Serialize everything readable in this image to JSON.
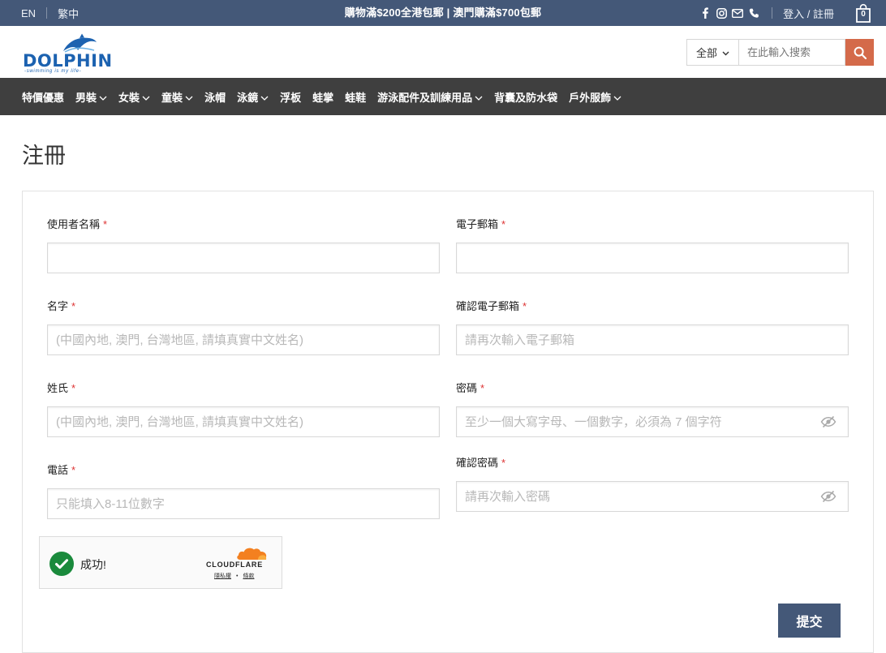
{
  "topbar": {
    "lang_en": "EN",
    "lang_zh": "繁中",
    "promo": "購物滿$200全港包郵 | 澳門購滿$700包郵",
    "login": "登入 / 註冊",
    "cart_count": "0",
    "icons": [
      "facebook-icon",
      "instagram-icon",
      "mail-icon",
      "phone-icon",
      "cart-icon"
    ]
  },
  "logo": {
    "word": "DOLPHIN",
    "tagline": "-swimming is my life-"
  },
  "search": {
    "category": "全部",
    "placeholder": "在此輸入搜索"
  },
  "nav": {
    "items": [
      {
        "label": "特價優惠",
        "dropdown": false
      },
      {
        "label": "男裝",
        "dropdown": true
      },
      {
        "label": "女裝",
        "dropdown": true
      },
      {
        "label": "童裝",
        "dropdown": true
      },
      {
        "label": "泳帽",
        "dropdown": false
      },
      {
        "label": "泳鏡",
        "dropdown": true
      },
      {
        "label": "浮板",
        "dropdown": false
      },
      {
        "label": "蛙掌",
        "dropdown": false
      },
      {
        "label": "蛙鞋",
        "dropdown": false
      },
      {
        "label": "游泳配件及訓練用品",
        "dropdown": true
      },
      {
        "label": "背囊及防水袋",
        "dropdown": false
      },
      {
        "label": "戶外服飾",
        "dropdown": true
      }
    ]
  },
  "page": {
    "title": "注冊"
  },
  "form": {
    "username": {
      "label": "使用者名稱",
      "req": "*",
      "value": "",
      "placeholder": ""
    },
    "email": {
      "label": "電子郵箱",
      "req": "*",
      "value": "",
      "placeholder": ""
    },
    "first_name": {
      "label": "名字",
      "req": "*",
      "placeholder": "(中國內地, 澳門, 台灣地區, 請填真實中文姓名)"
    },
    "confirm_email": {
      "label": "確認電子郵箱",
      "req": "*",
      "placeholder": "請再次輸入電子郵箱"
    },
    "last_name": {
      "label": "姓氏",
      "req": "*",
      "placeholder": "(中國內地, 澳門, 台灣地區, 請填真實中文姓名)"
    },
    "password": {
      "label": "密碼",
      "req": "*",
      "placeholder": "至少一個大寫字母、一個數字，必須為 7 個字符"
    },
    "phone": {
      "label": "電話",
      "req": "*",
      "placeholder": "只能填入8-11位數字"
    },
    "confirm_password": {
      "label": "確認密碼",
      "req": "*",
      "placeholder": "請再次輸入密碼"
    },
    "submit": "提交"
  },
  "turnstile": {
    "status": "成功!",
    "brand": "CLOUDFLARE",
    "privacy": "隱私權",
    "terms": "條款",
    "dot": "•"
  },
  "colors": {
    "topbar": "#445878",
    "nav": "#3f3f3f",
    "search_button": "#d46a4a",
    "logo": "#1c62b0",
    "required": "#dd3333",
    "success": "#1a8a3c"
  }
}
